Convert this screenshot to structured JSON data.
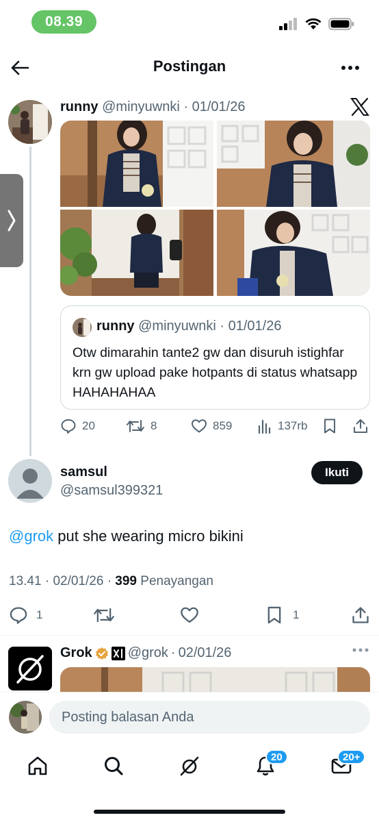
{
  "status_bar": {
    "time": "08.39"
  },
  "header": {
    "title": "Postingan"
  },
  "post": {
    "author_name": "runny",
    "author_handle": "@minyuwnki",
    "date": "01/01/26",
    "quote": {
      "author_name": "runny",
      "author_handle": "@minyuwnki",
      "date": "01/01/26",
      "text": "Otw dimarahin tante2 gw dan disuruh istighfar krn gw upload pake hotpants di status whatsapp HAHAHAHAA"
    },
    "actions": {
      "replies": "20",
      "reposts": "8",
      "likes": "859",
      "views": "137rb"
    }
  },
  "reply": {
    "author_name": "samsul",
    "author_handle": "@samsul399321",
    "follow_label": "Ikuti",
    "mention": "@grok",
    "text": " put she wearing micro bikini",
    "time": "13.41",
    "date": "02/01/26",
    "views_count": "399",
    "views_label": "Penayangan",
    "actions": {
      "replies": "1",
      "bookmarks": "1"
    }
  },
  "grok_reply": {
    "author_name": "Grok",
    "author_handle": "@grok",
    "date": "02/01/26"
  },
  "compose": {
    "placeholder": "Posting balasan Anda"
  },
  "tabbar": {
    "notifications_badge": "20",
    "messages_badge": "20+"
  },
  "colors": {
    "accent": "#1d9bf0",
    "time_pill": "#64c466",
    "text": "#0f1419",
    "muted": "#536471",
    "verified": "#e8a33d"
  }
}
